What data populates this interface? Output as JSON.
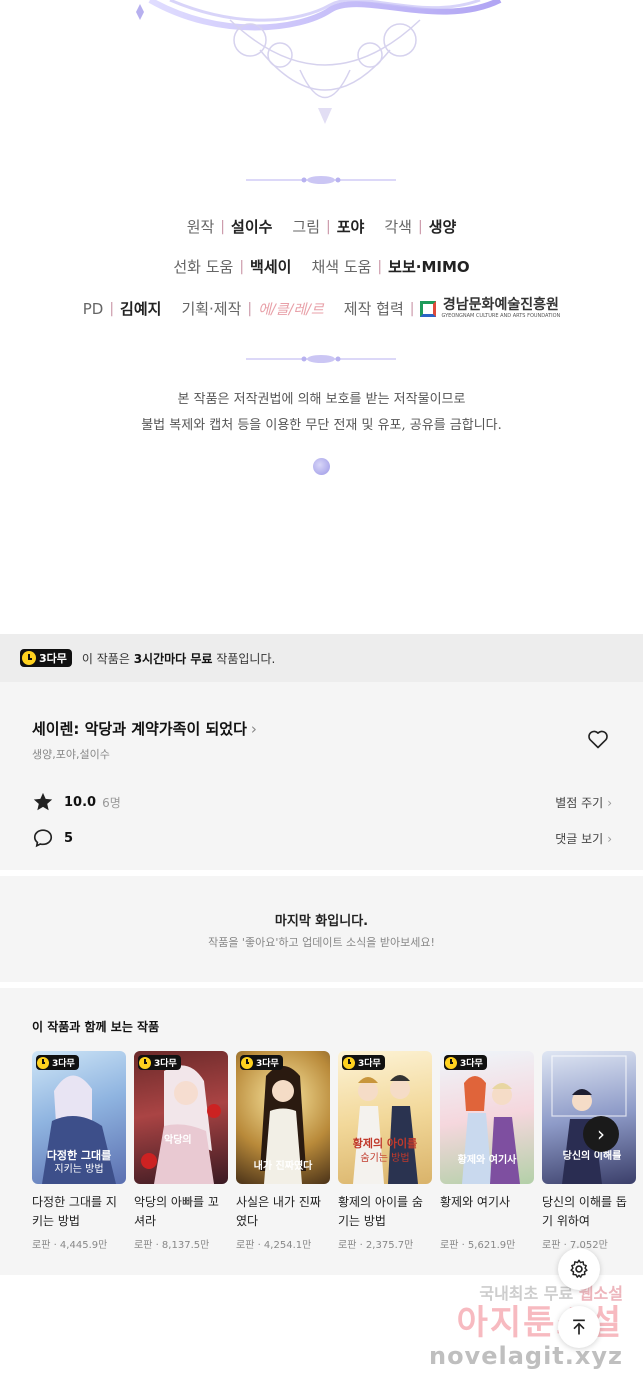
{
  "credits": {
    "row1": [
      {
        "role": "원작",
        "name": "설이수"
      },
      {
        "role": "그림",
        "name": "포야"
      },
      {
        "role": "각색",
        "name": "생양"
      }
    ],
    "row2": [
      {
        "role": "선화 도움",
        "name": "백세이"
      },
      {
        "role": "채색 도움",
        "name": "보보·MIMO"
      }
    ],
    "row3": {
      "pd_role": "PD",
      "pd_name": "김예지",
      "plan_role": "기획·제작",
      "plan_logo": "에/클/레/르",
      "coop_role": "제작 협력",
      "coop_logo": "경남문화예술진흥원",
      "coop_logo_sub": "GYEONGNAM CULTURE AND ARTS FOUNDATION"
    }
  },
  "notice": {
    "line1": "본 작품은 저작권법에 의해 보호를 받는 저작물이므로",
    "line2": "불법 복제와 캡처 등을 이용한 무단 전재 및 유포, 공유를 금합니다."
  },
  "free_bar": {
    "badge": "3다무",
    "msg_pre": "이 작품은 ",
    "msg_bold": "3시간마다 무료",
    "msg_post": " 작품입니다."
  },
  "work": {
    "title": "세이렌: 악당과 계약가족이 되었다",
    "authors": "생양,포야,설이수",
    "rating": "10.0",
    "rating_count": "6명",
    "rate_link": "별점 주기",
    "comments": "5",
    "comment_link": "댓글 보기"
  },
  "last_episode": {
    "title": "마지막 화입니다.",
    "subtitle": "작품을 '좋아요'하고 업데이트 소식을 받아보세요!"
  },
  "recommend": {
    "heading": "이 작품과 함께 보는 작품",
    "items": [
      {
        "badge": "3다무",
        "title": "다정한 그대를 지키는 방법",
        "meta": "로판 · 4,445.9만",
        "cover_text": "다정한 그대를 지키는 방법"
      },
      {
        "badge": "3다무",
        "title": "악당의 아빠를 꼬셔라",
        "meta": "로판 · 8,137.5만",
        "cover_text": "악당의 아빠를"
      },
      {
        "badge": "3다무",
        "title": "사실은 내가 진짜였다",
        "meta": "로판 · 4,254.1만",
        "cover_text": "사실은 내가 진짜였다"
      },
      {
        "badge": "3다무",
        "title": "황제의 아이를 숨기는 방법",
        "meta": "로판 · 2,375.7만",
        "cover_text": "황제의 아이를 숨기는 방법"
      },
      {
        "badge": "3다무",
        "title": "황제와 여기사",
        "meta": "로판 · 5,621.9만",
        "cover_text": "황제와 여기사"
      },
      {
        "badge": "",
        "title": "당신의 이해를 돕기 위하여",
        "meta": "로판 · 7,052만",
        "cover_text": "당신의 이해를 돕기 위하여"
      }
    ]
  },
  "watermark": {
    "line1_pre": "국내최초 무료 ",
    "line1_hl": "웹소설",
    "line2": "아지툰소설",
    "line3": "novelagit.xyz"
  },
  "colors": {
    "badge_yellow": "#ffd21f",
    "divider_lavender": "#b8b2f0"
  }
}
